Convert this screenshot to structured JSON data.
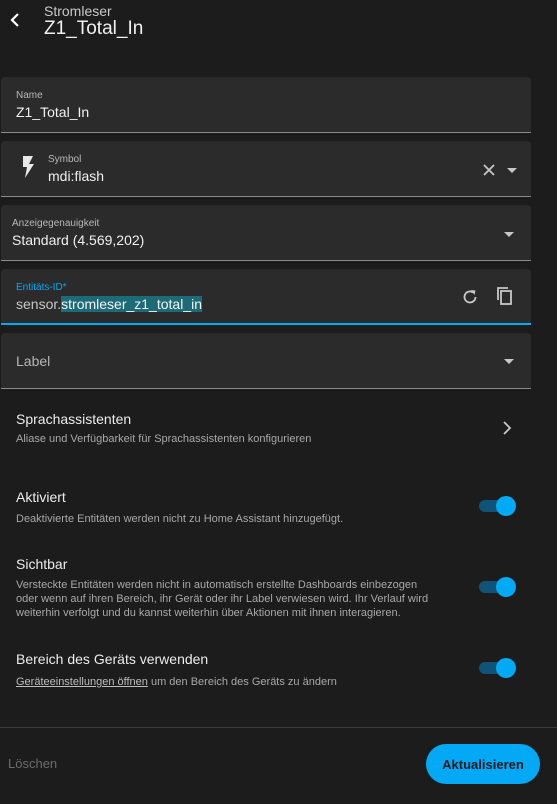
{
  "header": {
    "subtitle": "Stromleser",
    "title": "Z1_Total_In"
  },
  "name_field": {
    "label": "Name",
    "value": "Z1_Total_In"
  },
  "symbol_field": {
    "label": "Symbol",
    "value": "mdi:flash"
  },
  "precision_field": {
    "label": "Anzeigegenauigkeit",
    "value": "Standard (4.569,202)"
  },
  "entity_field": {
    "label": "Entitäts-ID*",
    "prefix": "sensor.",
    "value": "stromleser_z1_total_in"
  },
  "label_field": {
    "label": "Label"
  },
  "voice": {
    "title": "Sprachassistenten",
    "desc": "Aliase und Verfügbarkeit für Sprachassistenten konfigurieren"
  },
  "enabled": {
    "title": "Aktiviert",
    "desc": "Deaktivierte Entitäten werden nicht zu Home Assistant hinzugefügt.",
    "on": true
  },
  "visible": {
    "title": "Sichtbar",
    "desc_line1": "Versteckte Entitäten werden nicht in automatisch erstellte Dashboards einbezogen",
    "desc_line2": "oder wenn auf ihren Bereich, ihr Gerät oder ihr Label verwiesen wird. Ihr Verlauf wird",
    "desc_line3": "weiterhin verfolgt und du kannst weiterhin über Aktionen mit ihnen interagieren.",
    "on": true
  },
  "device_area": {
    "title": "Bereich des Geräts verwenden",
    "link": "Geräteeinstellungen öffnen",
    "desc_rest": " um den Bereich des Geräts zu ändern",
    "on": true
  },
  "footer": {
    "delete": "Löschen",
    "update": "Aktualisieren"
  },
  "colors": {
    "accent": "#03a9f4",
    "background": "#1c1c1c",
    "field": "#2b2b2b"
  }
}
